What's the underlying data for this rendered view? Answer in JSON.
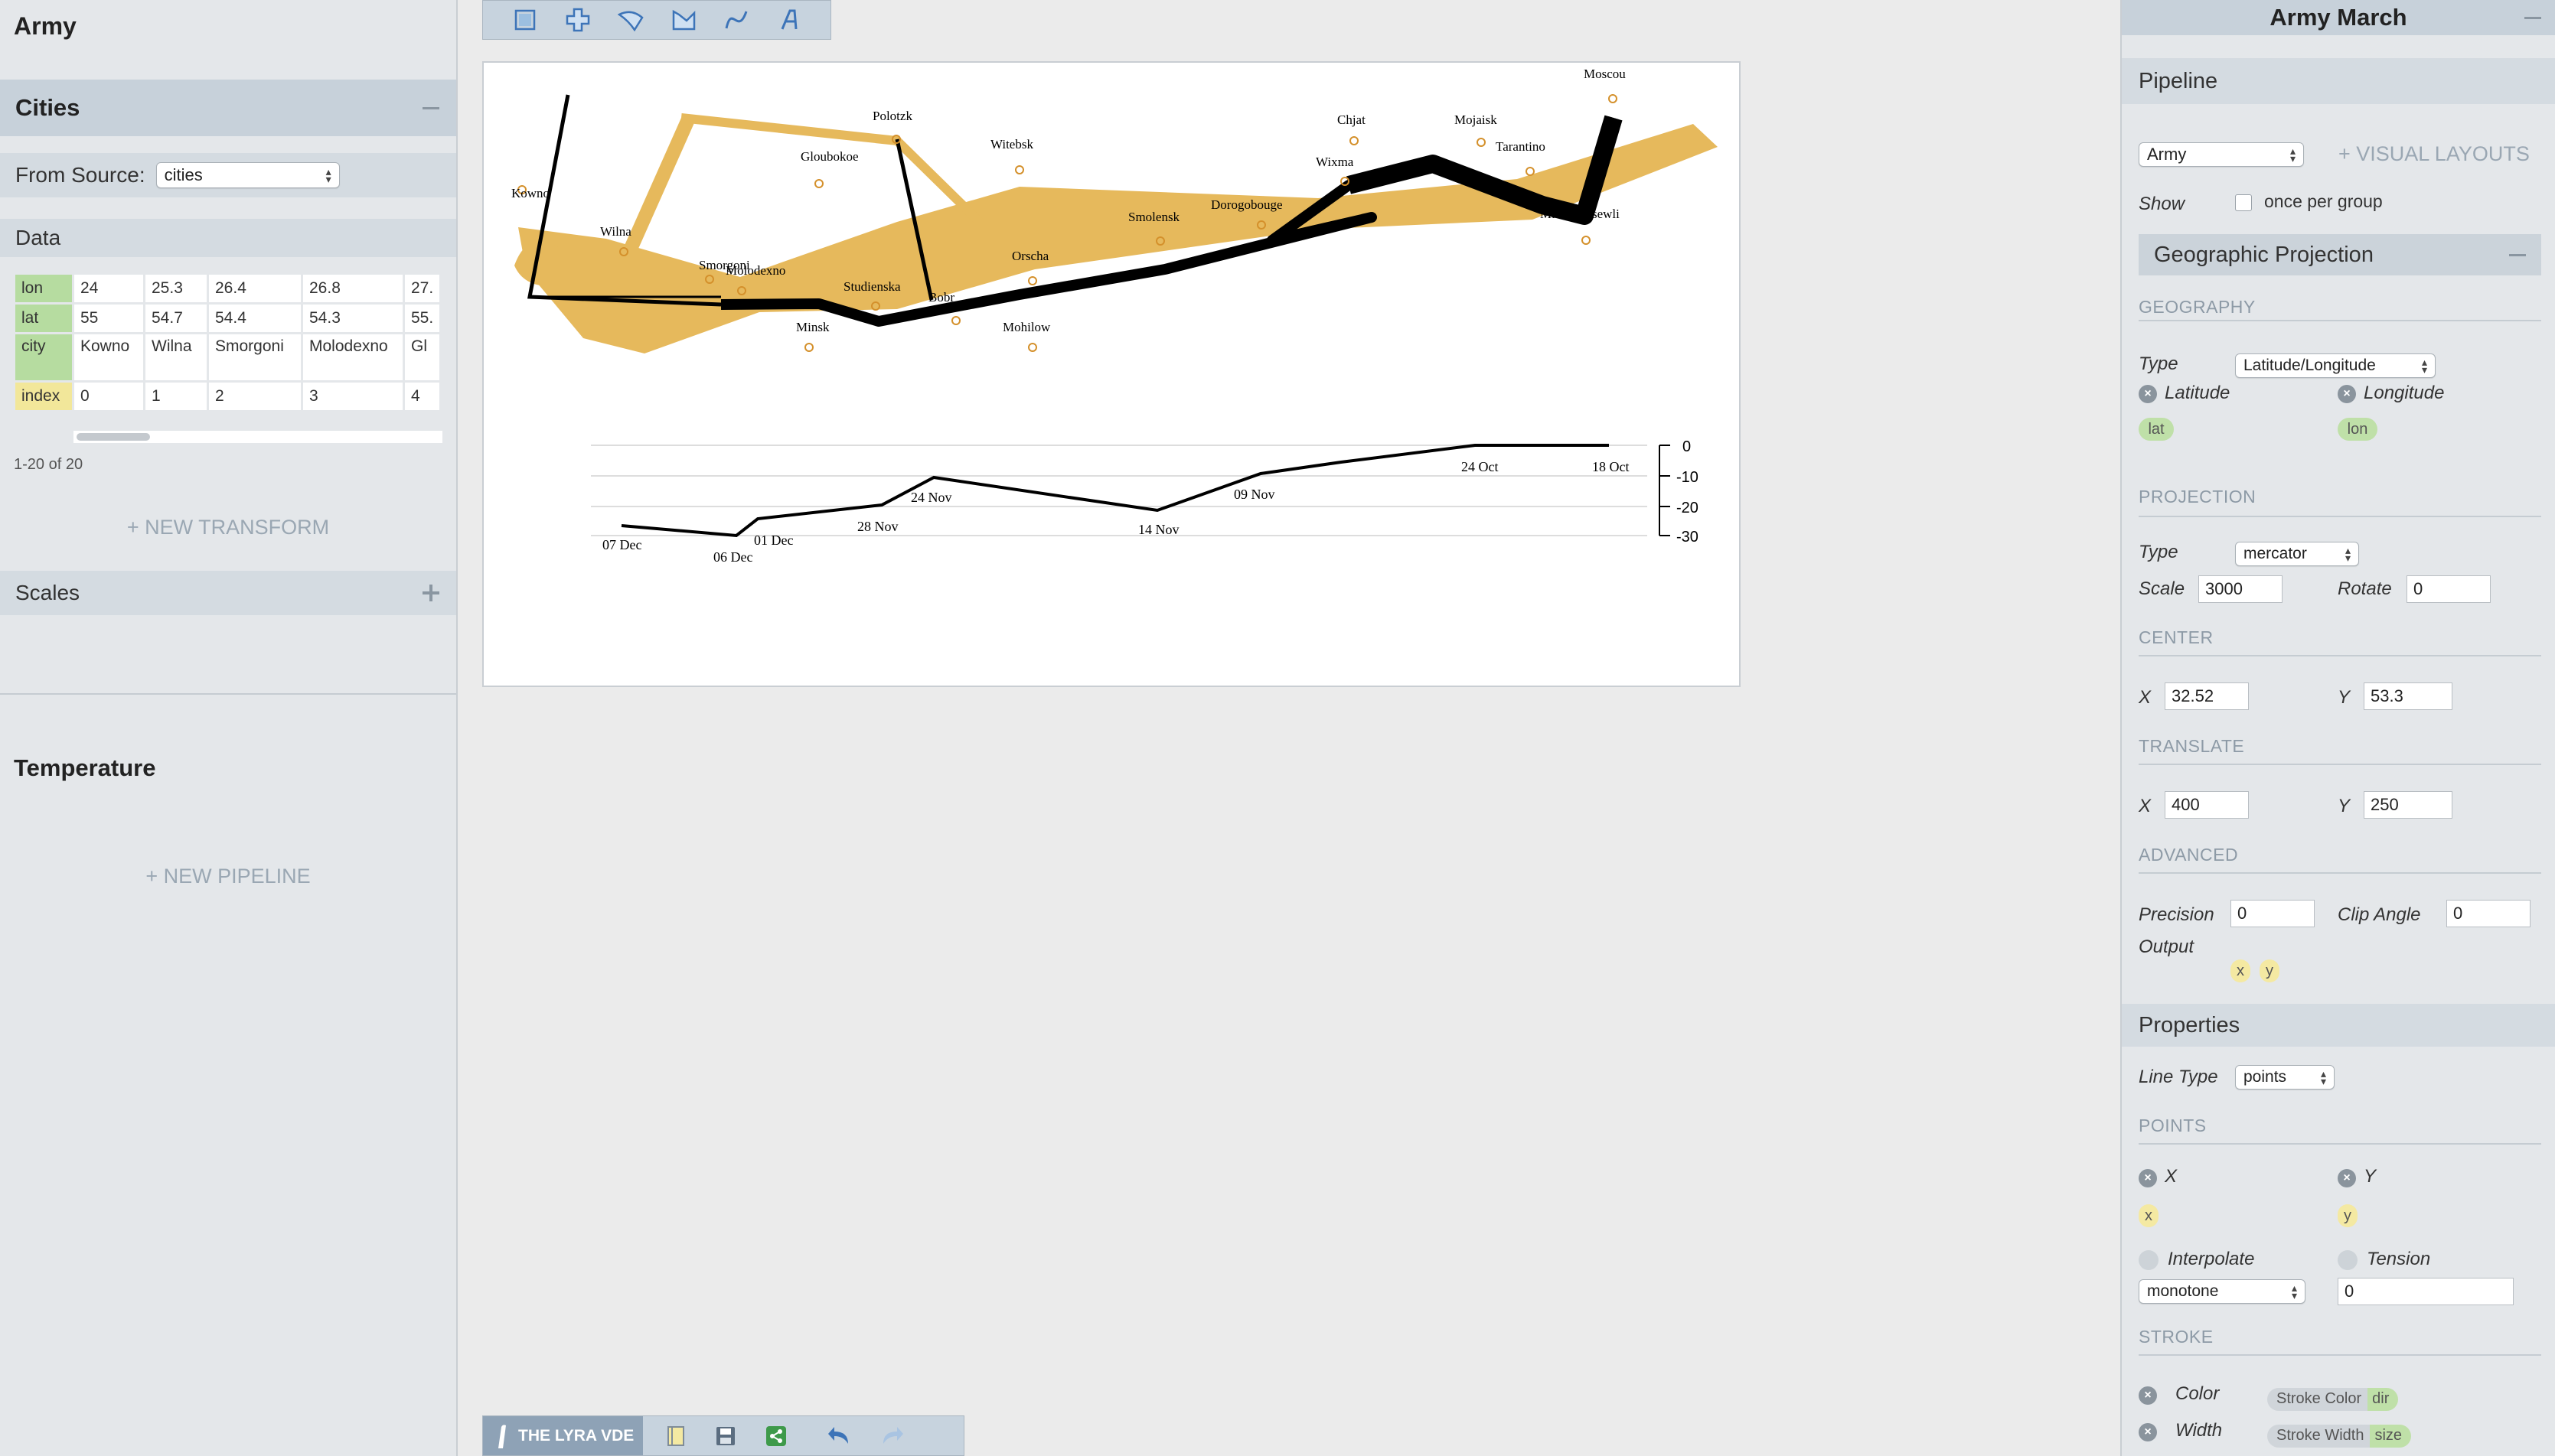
{
  "left": {
    "pipeline_title": "Army",
    "cities": {
      "title": "Cities",
      "from_source_label": "From Source:",
      "source_value": "cities"
    },
    "data_title": "Data",
    "table": {
      "rows": [
        {
          "field": "lon",
          "values": [
            "24",
            "25.3",
            "26.4",
            "26.8",
            "27."
          ]
        },
        {
          "field": "lat",
          "values": [
            "55",
            "54.7",
            "54.4",
            "54.3",
            "55."
          ]
        },
        {
          "field": "city",
          "values": [
            "Kowno",
            "Wilna",
            "Smorgoni",
            "Molodexno",
            "Gl"
          ]
        },
        {
          "field": "index",
          "values": [
            "0",
            "1",
            "2",
            "3",
            "4"
          ]
        }
      ]
    },
    "count": "1-20 of 20",
    "new_transform": "+ NEW TRANSFORM",
    "scales_title": "Scales",
    "temperature_title": "Temperature",
    "new_pipeline": "+ NEW PIPELINE"
  },
  "toolbar": {
    "tools": [
      "rect-tool-icon",
      "symbol-tool-icon",
      "arc-tool-icon",
      "area-tool-icon",
      "line-tool-icon",
      "text-tool-icon"
    ]
  },
  "map": {
    "cities": [
      {
        "name": "Kowno"
      },
      {
        "name": "Wilna"
      },
      {
        "name": "Smorgoni"
      },
      {
        "name": "Molodexno"
      },
      {
        "name": "Gloubokoe"
      },
      {
        "name": "Minsk"
      },
      {
        "name": "Studienska"
      },
      {
        "name": "Polotzk"
      },
      {
        "name": "Bobr"
      },
      {
        "name": "Witebsk"
      },
      {
        "name": "Orscha"
      },
      {
        "name": "Mohilow"
      },
      {
        "name": "Smolensk"
      },
      {
        "name": "Dorogobouge"
      },
      {
        "name": "Wixma"
      },
      {
        "name": "Chjat"
      },
      {
        "name": "Mojaisk"
      },
      {
        "name": "Moscou"
      },
      {
        "name": "Tarantino"
      },
      {
        "name": "Malo-jarosewli"
      }
    ],
    "temperature": {
      "ticks": [
        "0",
        "-10",
        "-20",
        "-30"
      ],
      "dates": [
        "18 Oct",
        "24 Oct",
        "09 Nov",
        "14 Nov",
        "24 Nov",
        "28 Nov",
        "01 Dec",
        "06 Dec",
        "07 Dec"
      ]
    }
  },
  "bottombar": {
    "title": "THE LYRA VDE",
    "icons": [
      "open-file-icon",
      "save-icon",
      "share-icon",
      "undo-icon",
      "redo-icon"
    ]
  },
  "right": {
    "title": "Army March",
    "pipeline_head": "Pipeline",
    "pipeline_value": "Army",
    "visual_layouts": "+ VISUAL LAYOUTS",
    "show_label": "Show",
    "once_per_group": "once per group",
    "geo_projection": "Geographic Projection",
    "geography": {
      "cap": "GEOGRAPHY",
      "type_label": "Type",
      "type_value": "Latitude/Longitude",
      "lat_label": "Latitude",
      "lon_label": "Longitude",
      "lat_pill": "lat",
      "lon_pill": "lon"
    },
    "projection": {
      "cap": "PROJECTION",
      "type_label": "Type",
      "type_value": "mercator",
      "scale_label": "Scale",
      "scale_value": "3000",
      "rotate_label": "Rotate",
      "rotate_value": "0"
    },
    "center": {
      "cap": "CENTER",
      "x_label": "X",
      "x_value": "32.52",
      "y_label": "Y",
      "y_value": "53.3"
    },
    "translate": {
      "cap": "TRANSLATE",
      "x_label": "X",
      "x_value": "400",
      "y_label": "Y",
      "y_value": "250"
    },
    "advanced": {
      "cap": "ADVANCED",
      "precision_label": "Precision",
      "precision_value": "0",
      "clip_label": "Clip Angle",
      "clip_value": "0",
      "output_label": "Output",
      "out_x": "x",
      "out_y": "y"
    },
    "properties": {
      "head": "Properties",
      "line_type_label": "Line Type",
      "line_type_value": "points",
      "points_cap": "POINTS",
      "x_label": "X",
      "y_label": "Y",
      "x_pill": "x",
      "y_pill": "y",
      "interpolate_label": "Interpolate",
      "tension_label": "Tension",
      "interpolate_value": "monotone",
      "tension_value": "0",
      "stroke_cap": "STROKE",
      "color_label": "Color",
      "width_label": "Width",
      "color_scale": "Stroke Color",
      "color_field": "dir",
      "width_scale": "Stroke Width",
      "width_field": "size"
    }
  },
  "colors": {
    "advance": "#e6b95c",
    "retreat": "#000000",
    "panel": "#e4e7ea",
    "header": "#c7d1da"
  }
}
